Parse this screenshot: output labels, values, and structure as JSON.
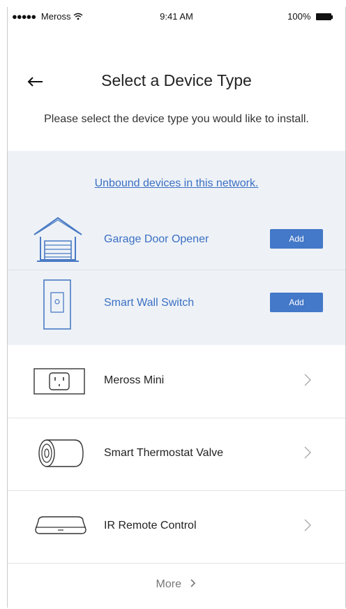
{
  "status_bar": {
    "carrier": "Meross",
    "time": "9:41 AM",
    "battery": "100%"
  },
  "header": {
    "title": "Select a Device Type"
  },
  "subtitle": "Please select the device type you would like to install.",
  "unbound_link": "Unbound devices in this network.",
  "unbound_devices": [
    {
      "label": "Garage Door Opener",
      "icon": "garage-door-icon",
      "button": "Add"
    },
    {
      "label": "Smart Wall Switch",
      "icon": "wall-switch-icon",
      "button": "Add"
    }
  ],
  "device_types": [
    {
      "label": "Meross Mini",
      "icon": "smart-plug-icon"
    },
    {
      "label": "Smart Thermostat Valve",
      "icon": "thermostat-valve-icon"
    },
    {
      "label": "IR Remote Control",
      "icon": "ir-remote-icon"
    }
  ],
  "more": {
    "label": "More"
  },
  "colors": {
    "accent": "#4478c8",
    "link": "#3b6fc3",
    "bound_bg": "#eef2f7"
  }
}
